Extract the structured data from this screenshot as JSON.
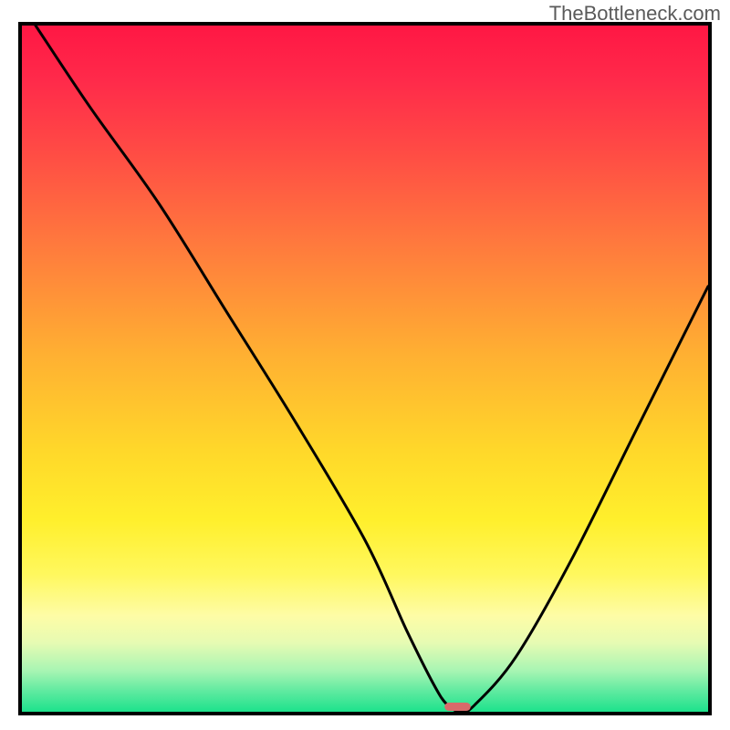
{
  "watermark": "TheBottleneck.com",
  "chart_data": {
    "type": "line",
    "title": "",
    "xlabel": "",
    "ylabel": "",
    "xlim": [
      0,
      100
    ],
    "ylim": [
      0,
      100
    ],
    "grid": false,
    "legend": false,
    "series": [
      {
        "name": "bottleneck-curve",
        "x": [
          2,
          10,
          20,
          30,
          40,
          50,
          56,
          60,
          62,
          64,
          66,
          72,
          80,
          90,
          100
        ],
        "y": [
          100,
          88,
          74,
          58,
          42,
          25,
          12,
          4,
          1,
          0,
          1,
          8,
          22,
          42,
          62
        ]
      }
    ],
    "marker": {
      "name": "optimal-point",
      "x": 63.5,
      "y": 0,
      "width_frac": 0.038,
      "height_frac": 0.012,
      "color": "#d86a6a"
    },
    "background_gradient": {
      "top": "#ff1744",
      "mid": "#ffd82a",
      "bottom": "#1de28c"
    }
  }
}
